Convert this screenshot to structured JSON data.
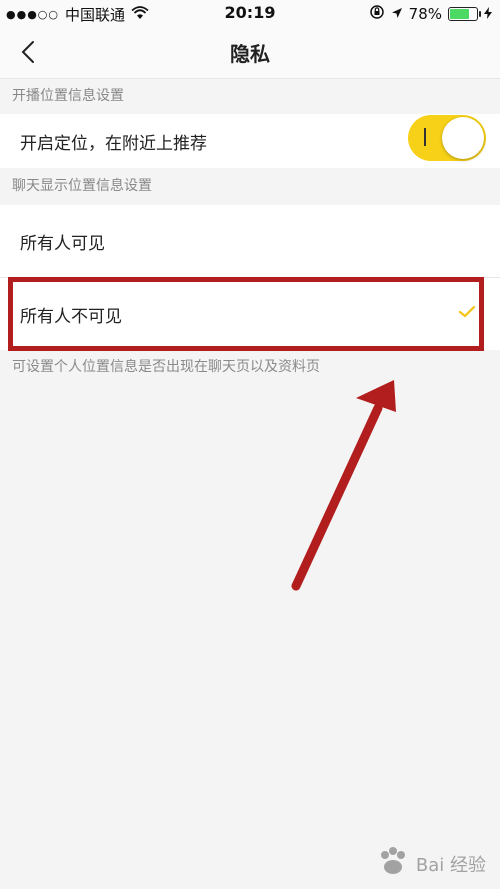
{
  "status_bar": {
    "carrier": "中国联通",
    "time": "20:19",
    "battery_percent": "78%",
    "battery_level": 0.78
  },
  "nav": {
    "title": "隐私"
  },
  "sections": {
    "location_broadcast": {
      "header": "开播位置信息设置",
      "toggle_label": "开启定位，在附近上推荐",
      "toggle_on": true
    },
    "chat_location": {
      "header": "聊天显示位置信息设置",
      "options": [
        {
          "label": "所有人可见",
          "selected": false
        },
        {
          "label": "所有人不可见",
          "selected": true
        }
      ],
      "footnote": "可设置个人位置信息是否出现在聊天页以及资料页"
    }
  },
  "watermark": {
    "text": "Bai 经验"
  },
  "colors": {
    "accent": "#f7d117",
    "annotation": "#b21d1d",
    "background": "#f4f4f4"
  }
}
